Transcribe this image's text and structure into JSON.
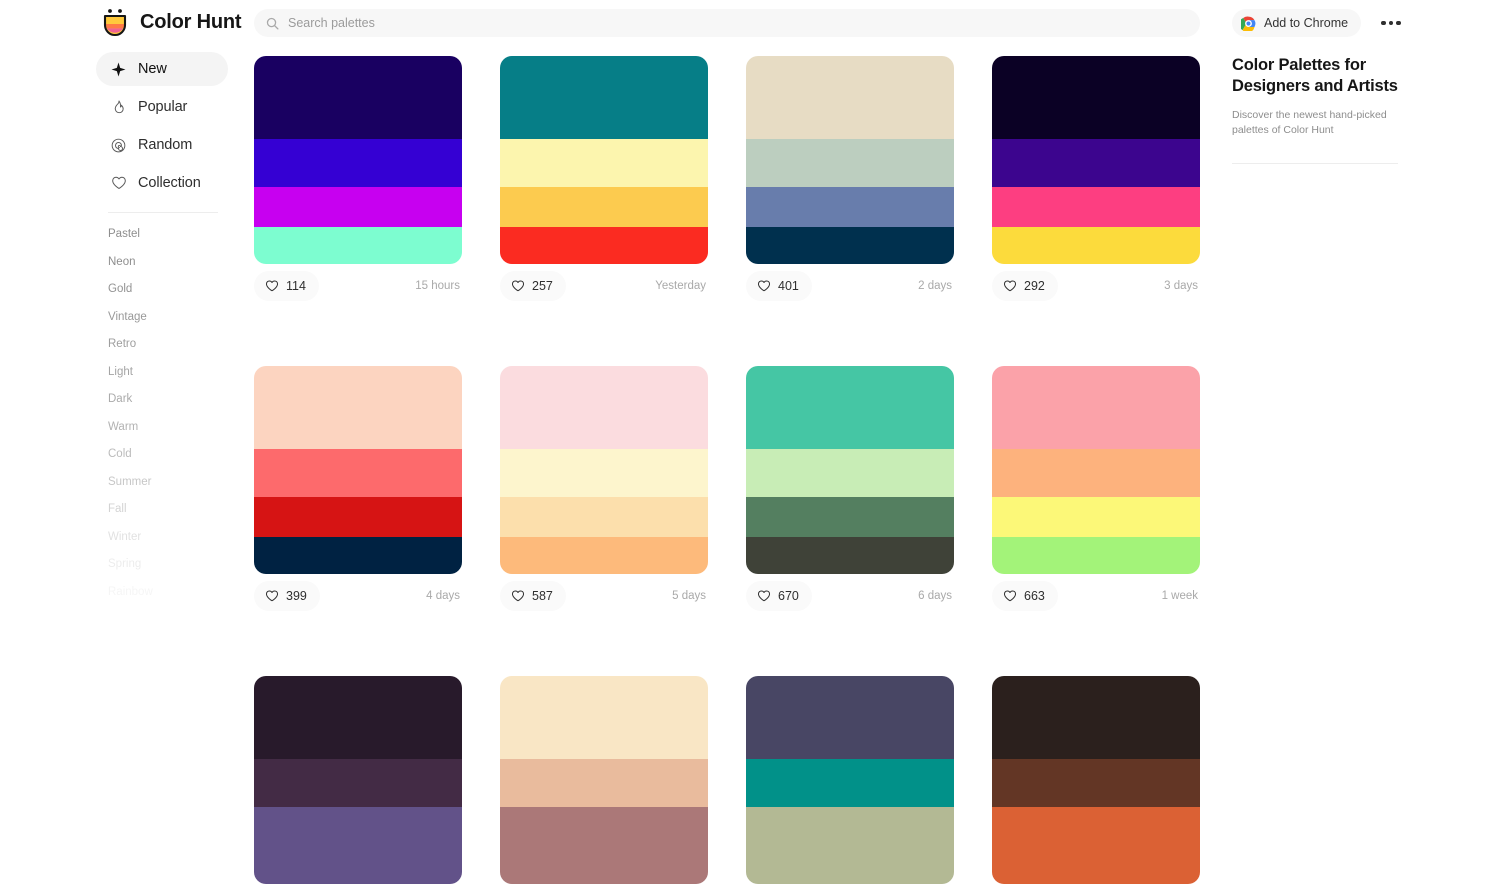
{
  "header": {
    "brand_name": "Color Hunt",
    "logo_icon": "colorhunt-logo-icon",
    "search": {
      "icon": "search-icon",
      "placeholder": "Search palettes",
      "value": ""
    },
    "chrome_button": {
      "label": "Add to Chrome",
      "icon": "chrome-icon"
    },
    "more_menu": {
      "icon": "three-dots-icon",
      "label": "More"
    }
  },
  "sidebar": {
    "nav": [
      {
        "label": "New",
        "icon": "sparkle-icon",
        "active": true
      },
      {
        "label": "Popular",
        "icon": "flame-icon",
        "active": false
      },
      {
        "label": "Random",
        "icon": "spiral-icon",
        "active": false
      },
      {
        "label": "Collection",
        "icon": "heart-icon",
        "active": false
      }
    ],
    "tags": [
      {
        "label": "Pastel",
        "opacity": 1.0
      },
      {
        "label": "Neon",
        "opacity": 1.0
      },
      {
        "label": "Gold",
        "opacity": 0.95
      },
      {
        "label": "Vintage",
        "opacity": 0.9
      },
      {
        "label": "Retro",
        "opacity": 0.85
      },
      {
        "label": "Light",
        "opacity": 0.8
      },
      {
        "label": "Dark",
        "opacity": 0.75
      },
      {
        "label": "Warm",
        "opacity": 0.68
      },
      {
        "label": "Cold",
        "opacity": 0.6
      },
      {
        "label": "Summer",
        "opacity": 0.5
      },
      {
        "label": "Fall",
        "opacity": 0.38
      },
      {
        "label": "Winter",
        "opacity": 0.26
      },
      {
        "label": "Spring",
        "opacity": 0.16
      },
      {
        "label": "Rainbow",
        "opacity": 0.08
      }
    ]
  },
  "right_panel": {
    "title": "Color Palettes for Designers and Artists",
    "subtitle": "Discover the newest hand-picked palettes of Color Hunt"
  },
  "palettes": [
    {
      "colors": [
        "#190061",
        "#3500D3",
        "#C700F0",
        "#7DFDD0"
      ],
      "likes": "114",
      "time": "15 hours",
      "like_icon": "heart-icon"
    },
    {
      "colors": [
        "#067E87",
        "#FCF5AE",
        "#FCCB4F",
        "#FB2B21"
      ],
      "likes": "257",
      "time": "Yesterday",
      "like_icon": "heart-icon"
    },
    {
      "colors": [
        "#E7DCC4",
        "#BCCEBF",
        "#687DAC",
        "#00304E"
      ],
      "likes": "401",
      "time": "2 days",
      "like_icon": "heart-icon"
    },
    {
      "colors": [
        "#0B0125",
        "#3C058E",
        "#FD3E81",
        "#FCDB3C"
      ],
      "likes": "292",
      "time": "3 days",
      "like_icon": "heart-icon"
    },
    {
      "colors": [
        "#FCD4C0",
        "#FD6A6C",
        "#D61414",
        "#002242"
      ],
      "likes": "399",
      "time": "4 days",
      "like_icon": "heart-icon"
    },
    {
      "colors": [
        "#FBDCDF",
        "#FDF5CD",
        "#FCDFAC",
        "#FDBA7B"
      ],
      "likes": "587",
      "time": "5 days",
      "like_icon": "heart-icon"
    },
    {
      "colors": [
        "#45C6A4",
        "#C8EDB6",
        "#547F60",
        "#3F4238"
      ],
      "likes": "670",
      "time": "6 days",
      "like_icon": "heart-icon"
    },
    {
      "colors": [
        "#FBA2A9",
        "#FDB27D",
        "#FCF878",
        "#A3F379"
      ],
      "likes": "663",
      "time": "1 week",
      "like_icon": "heart-icon"
    },
    {
      "colors": [
        "#281A2B",
        "#432B45",
        "#625289",
        "#625289"
      ],
      "likes": "",
      "time": "",
      "like_icon": "heart-icon"
    },
    {
      "colors": [
        "#F9E6C5",
        "#E9BB9D",
        "#AB7878",
        "#AB7878"
      ],
      "likes": "",
      "time": "",
      "like_icon": "heart-icon"
    },
    {
      "colors": [
        "#484664",
        "#019189",
        "#B3B994",
        "#B3B994"
      ],
      "likes": "",
      "time": "",
      "like_icon": "heart-icon"
    },
    {
      "colors": [
        "#2B201D",
        "#633625",
        "#DB6134",
        "#DB6134"
      ],
      "likes": "",
      "time": "",
      "like_icon": "heart-icon"
    }
  ]
}
